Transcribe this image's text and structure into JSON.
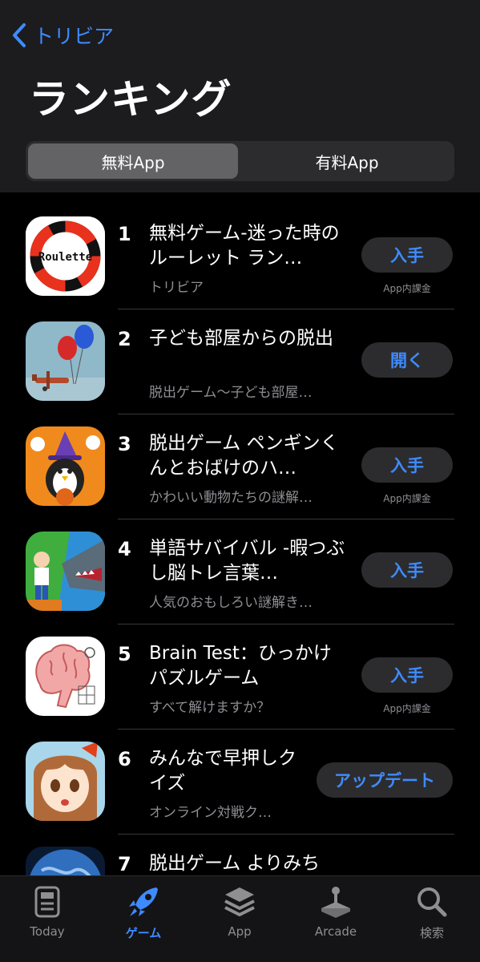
{
  "nav": {
    "back_label": "トリビア",
    "title": "ランキング"
  },
  "segment": {
    "free": "無料App",
    "paid": "有料App"
  },
  "apps": [
    {
      "rank": "1",
      "name": "無料ゲーム-迷った時のルーレット ラン…",
      "subtitle": "トリビア",
      "action": "入手",
      "iap": "App内課金",
      "icon": "roulette-icon",
      "icon_text": "Roulette"
    },
    {
      "rank": "2",
      "name": "子ども部屋からの脱出",
      "subtitle": "脱出ゲーム〜子ども部屋…",
      "action": "開く",
      "iap": "",
      "icon": "balloon-plane-icon"
    },
    {
      "rank": "3",
      "name": "脱出ゲーム ペンギンくんとおばけのハ…",
      "subtitle": "かわいい動物たちの謎解…",
      "action": "入手",
      "iap": "App内課金",
      "icon": "penguin-witch-icon"
    },
    {
      "rank": "4",
      "name": "単語サバイバル -暇つぶし脳トレ言葉…",
      "subtitle": "人気のおもしろい謎解き…",
      "action": "入手",
      "iap": "",
      "icon": "shark-man-icon"
    },
    {
      "rank": "5",
      "name": "Brain Test：ひっかけパズルゲーム",
      "subtitle": "すべて解けますか？",
      "action": "入手",
      "iap": "App内課金",
      "icon": "brain-icon"
    },
    {
      "rank": "6",
      "name": "みんなで早押しクイズ",
      "subtitle": "オンライン対戦ク…",
      "action": "アップデート",
      "iap": "",
      "icon": "anime-girl-icon"
    },
    {
      "rank": "7",
      "name": "脱出ゲーム よりみち",
      "subtitle": "",
      "action": "",
      "iap": "",
      "icon": "globe-icon"
    }
  ],
  "tabs": [
    {
      "label": "Today",
      "icon": "today-icon",
      "active": false
    },
    {
      "label": "ゲーム",
      "icon": "rocket-icon",
      "active": true
    },
    {
      "label": "App",
      "icon": "layers-icon",
      "active": false
    },
    {
      "label": "Arcade",
      "icon": "joystick-icon",
      "active": false
    },
    {
      "label": "検索",
      "icon": "search-icon",
      "active": false
    }
  ],
  "colors": {
    "accent": "#3e8bff",
    "background": "#000000",
    "header": "#1c1c1e",
    "button": "#2c2c2e",
    "secondary_text": "#8e8e93"
  }
}
